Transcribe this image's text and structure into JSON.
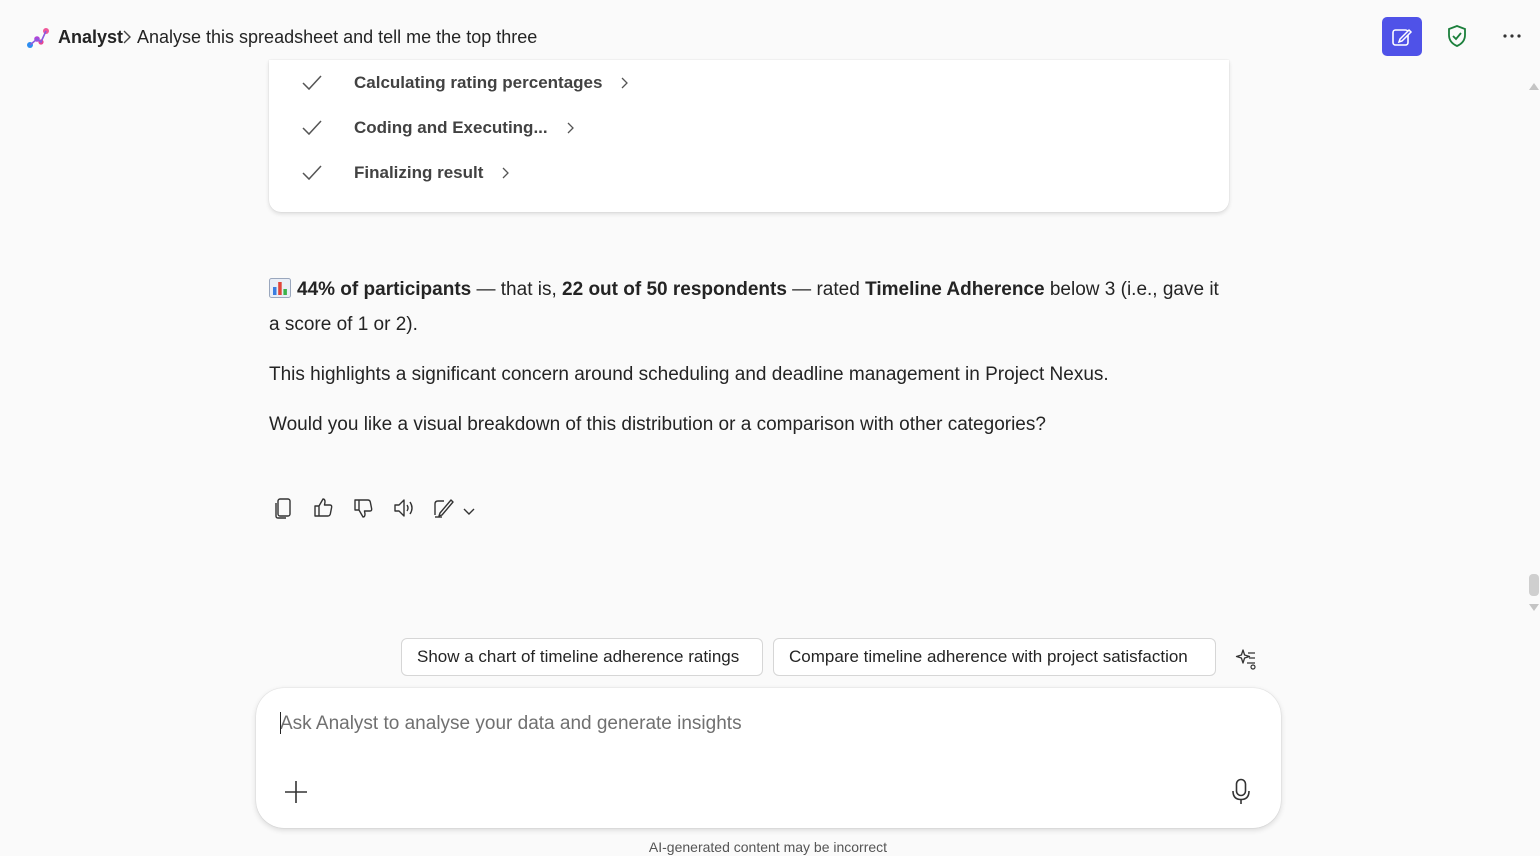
{
  "header": {
    "app_name": "Analyst",
    "breadcrumb_title": "Analyse this spreadsheet and tell me the top three",
    "icons": [
      "analyst-logo-icon",
      "chevron-right-icon",
      "compose-icon",
      "shield-check-icon",
      "more-icon"
    ],
    "accent_color": "#4f52e8"
  },
  "steps": [
    {
      "label": "Calculating rating percentages",
      "status": "done"
    },
    {
      "label": "Coding and Executing...",
      "status": "done"
    },
    {
      "label": "Finalizing result",
      "status": "done"
    }
  ],
  "answer": {
    "p1": {
      "emoji": "bar-chart-emoji",
      "bold1": "44% of participants",
      "text1": " — that is, ",
      "bold2": "22 out of 50 respondents",
      "text2": " — rated ",
      "bold3": "Timeline Adherence",
      "text3": " below 3 (i.e., gave it a score of 1 or 2)."
    },
    "p2": "This highlights a significant concern around scheduling and deadline management in Project Nexus.",
    "p3": "Would you like a visual breakdown of this distribution or a comparison with other categories?"
  },
  "message_actions": [
    "copy-icon",
    "thumbs-up-icon",
    "thumbs-down-icon",
    "read-aloud-icon",
    "edit-rewrite-icon",
    "chevron-down-icon"
  ],
  "suggestions": [
    "Show a chart of timeline adherence ratings",
    "Compare timeline adherence with project satisfaction"
  ],
  "composer": {
    "placeholder": "Ask Analyst to analyse your data and generate insights",
    "value": ""
  },
  "footer": {
    "disclaimer": "AI-generated content may be incorrect"
  }
}
